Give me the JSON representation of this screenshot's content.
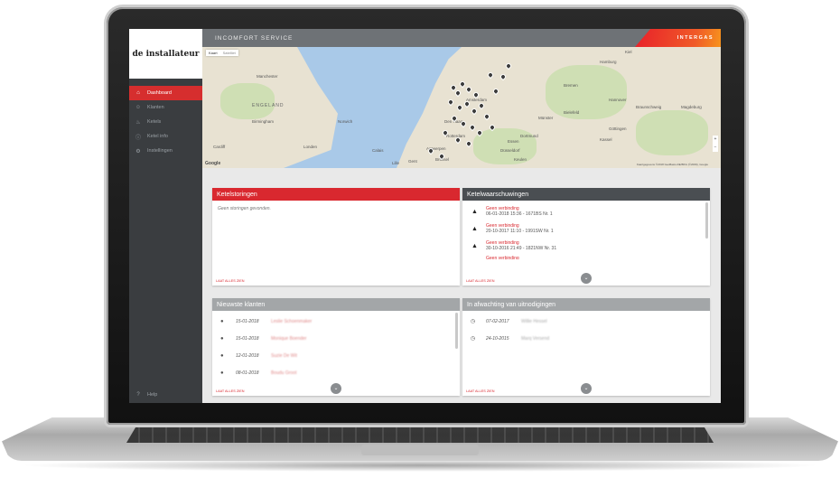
{
  "sidebar": {
    "brand": "de installateur",
    "items": [
      {
        "label": "Dashboard",
        "icon": "home-icon",
        "glyph": "⌂"
      },
      {
        "label": "Klanten",
        "icon": "users-icon",
        "glyph": "☺"
      },
      {
        "label": "Ketels",
        "icon": "flame-icon",
        "glyph": "♨"
      },
      {
        "label": "Ketel info",
        "icon": "info-icon",
        "glyph": "ⓘ"
      },
      {
        "label": "Instellingen",
        "icon": "gear-icon",
        "glyph": "⚙"
      }
    ],
    "help": "Help"
  },
  "header": {
    "title": "INCOMFORT SERVICE",
    "logo": "INTERGAS"
  },
  "map": {
    "type_options": [
      "Kaart",
      "Satelliet"
    ],
    "labels": [
      "ENGELAND",
      "Londen",
      "Birmingham",
      "Cardiff",
      "Manchester",
      "Norwich",
      "Amsterdam",
      "Den Haag",
      "Rotterdam",
      "Brussel",
      "Antwerpen",
      "Gent",
      "Lille",
      "Calais",
      "Essen",
      "Dortmund",
      "Düsseldorf",
      "Keulen",
      "Hamburg",
      "Bremen",
      "Hannover",
      "Bielefeld",
      "Braunschweig",
      "Magdeburg",
      "Kiel",
      "Göttingen",
      "Kassel",
      "Münster"
    ],
    "google": "Google",
    "credits": "Kaartgegevens ©2018 GeoBasis-DE/BKG (©2009), Google"
  },
  "panels": {
    "storingen": {
      "title": "Ketelstoringen",
      "empty": "Geen storingen gevonden.",
      "see_all": "LAAT ALLES ZIEN"
    },
    "waarschuwingen": {
      "title": "Ketelwaarschuwingen",
      "items": [
        {
          "title": "Geen verbinding",
          "sub": "06-01-2018 15:36 - 1671BS Nr. 1"
        },
        {
          "title": "Geen verbinding",
          "sub": "20-10-2017 11:10 - 1991SW Nr. 1"
        },
        {
          "title": "Geen verbinding",
          "sub": "30-10-2016 21:49 - 1821NW Nr. 31"
        }
      ],
      "more": "Geen verbinding",
      "see_all": "LAAT ALLES ZIEN"
    },
    "klanten": {
      "title": "Nieuwste klanten",
      "rows": [
        {
          "date": "15-01-2018",
          "name": "Leslie Schoenmaker"
        },
        {
          "date": "15-01-2018",
          "name": "Monique Boender"
        },
        {
          "date": "12-01-2018",
          "name": "Suzie De Wit"
        },
        {
          "date": "08-01-2018",
          "name": "Boudu Groot"
        }
      ],
      "see_all": "LAAT ALLES ZIEN"
    },
    "uitnodigingen": {
      "title": "In afwachting van uitnodigingen",
      "rows": [
        {
          "date": "07-02-2017",
          "name": "Willie Hessel"
        },
        {
          "date": "24-10-2015",
          "name": "Marq Versend"
        }
      ],
      "see_all": "LAAT ALLES ZIEN"
    }
  }
}
